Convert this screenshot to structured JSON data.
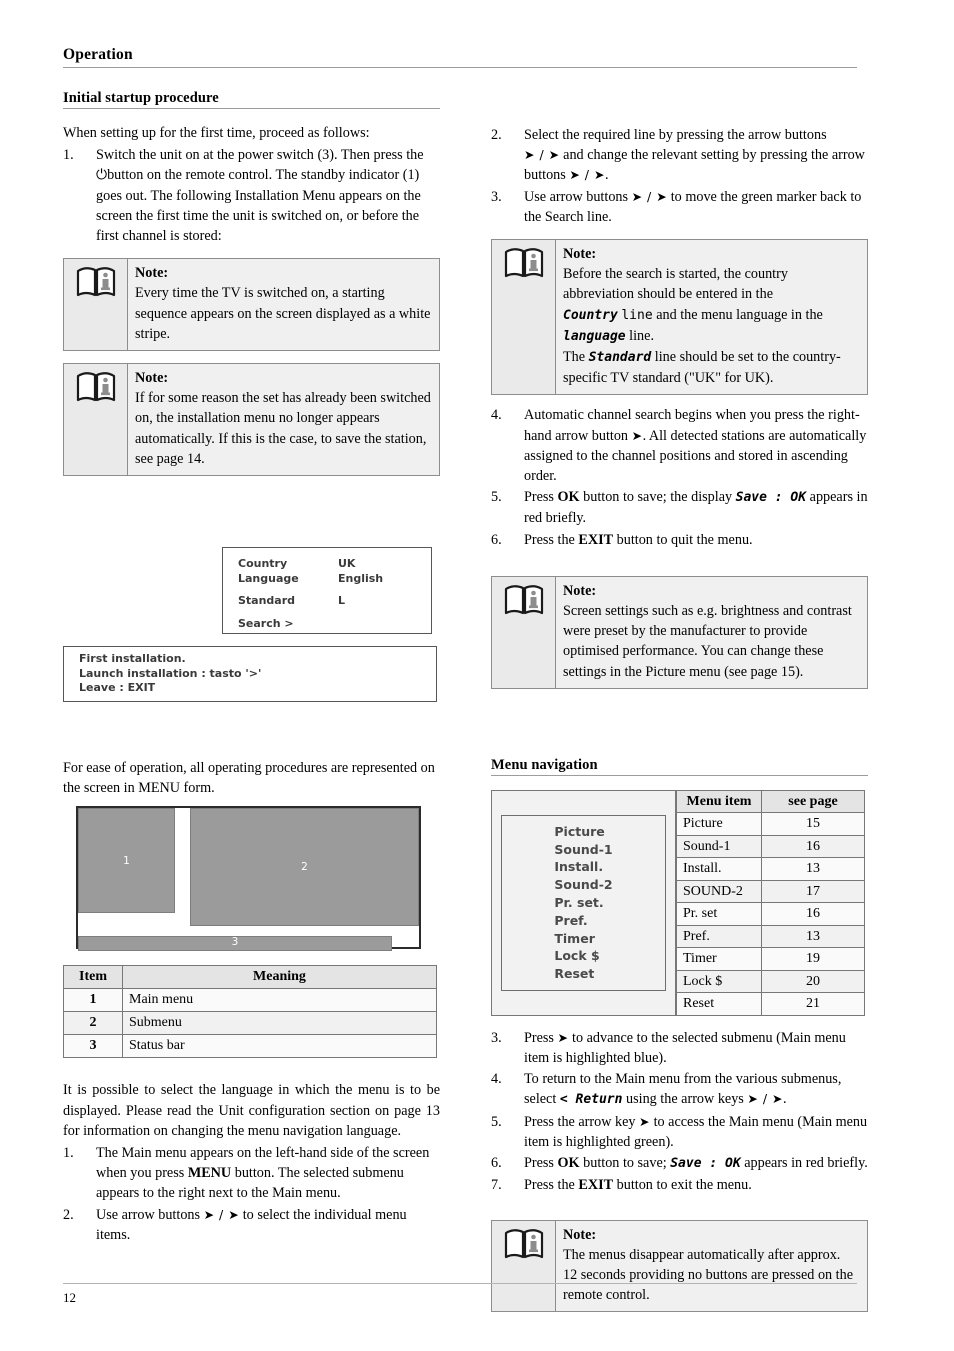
{
  "header": {
    "running_title": "Operation"
  },
  "footer": {
    "page_number": "12"
  },
  "left": {
    "section_title": "Initial startup procedure",
    "intro": "When setting up for the first time, proceed as follows:",
    "step1": {
      "num": "1.",
      "part_a": "Switch the unit on at the power switch (3). Then press the",
      "power_glyph": "⏻",
      "part_b": "button on the remote control. The standby indicator (1) goes out. The following Installation Menu appears on the screen the first time the unit is switched on, or before the first channel is stored:"
    },
    "note1": {
      "title": "Note:",
      "text": "Every time the TV is switched on, a starting sequence appears on the screen displayed as a white stripe."
    },
    "note2": {
      "title": "Note:",
      "text": "If for some reason the set has already been switched on, the installation menu no longer appears automatically. If this is the case, to save the station, see page 14."
    },
    "osd": {
      "rows": [
        {
          "key": "Country",
          "value": "UK"
        },
        {
          "key": "Language",
          "value": "English"
        },
        {
          "key": "Standard",
          "value": "L"
        },
        {
          "key": "Search  >",
          "value": ""
        }
      ],
      "status": [
        "First installation.",
        "Launch installation : tasto '>'",
        "Leave : EXIT"
      ]
    },
    "menu_form_text": "For ease of operation, all operating procedures are represented on the screen in MENU form.",
    "diagram": {
      "box1": "1",
      "box2": "2",
      "box3": "3"
    },
    "item_table": {
      "headers": [
        "Item",
        "Meaning"
      ],
      "rows": [
        [
          "1",
          "Main menu"
        ],
        [
          "2",
          "Submenu"
        ],
        [
          "3",
          "Status bar"
        ]
      ]
    },
    "language_para": "It is possible to select the language in which the menu is to be displayed. Please read the Unit configuration section on page 13 for information on changing the menu navigation language.",
    "steps_b": [
      {
        "num": "1.",
        "a": "The Main menu appears on the left-hand side of the screen when you press ",
        "bold": "MENU",
        "b": " button. The selected submenu appears to the right next to the Main menu."
      },
      {
        "num": "2.",
        "a": "Use arrow buttons ",
        "arrows": "➤ / ➤",
        "b": " to select the individual menu items."
      }
    ]
  },
  "right": {
    "step2": {
      "num": "2.",
      "a": "Select the required line by pressing the arrow buttons",
      "arrows_ud": "➤ / ➤",
      "b": " and change the relevant setting by pressing the arrow buttons ",
      "arrows_lr": "➤ / ➤",
      "c": "."
    },
    "step3": {
      "num": "3.",
      "a": "Use arrow buttons ",
      "arrows_ud": "➤ / ➤",
      "b": " to move the green marker back to the Search line."
    },
    "note3": {
      "title": "Note:",
      "l1_a": "Before the search is started, the country abbreviation should be entered in the ",
      "l1_kw": "Country",
      "l1_kw2": "line",
      "l1_b": " and the menu language in the ",
      "l1_kw3": "language",
      "l1_c": " line.",
      "l2_a": "The ",
      "l2_kw": "Standard",
      "l2_b": " line should be set to the country-specific TV standard (\"UK\" for UK)."
    },
    "step4": {
      "num": "4.",
      "a": "Automatic channel search begins when you press the right-hand arrow button ",
      "arrow": "➤",
      "b": ". All detected stations are automatically assigned to the channel positions and stored in ascending order."
    },
    "step5": {
      "num": "5.",
      "a": "Press ",
      "bold": "OK",
      "b": " button to save; the display ",
      "kw": "Save  :  OK",
      "c": " appears in red briefly."
    },
    "step6": {
      "num": "6.",
      "a": "Press the ",
      "bold": "EXIT",
      "b": " button to quit the menu."
    },
    "note4": {
      "title": "Note:",
      "text": "Screen settings such as e.g. brightness and contrast were preset by the manufacturer to provide optimised performance. You can change these settings in the Picture menu (see page 15)."
    },
    "section_title": "Menu navigation",
    "osd_menu_items": [
      "Picture",
      "Sound-1",
      "Install.",
      "Sound-2",
      "Pr. set.",
      "Pref.",
      "Timer",
      "Lock $",
      "Reset"
    ],
    "nav_table": {
      "headers": [
        "Menu item",
        "see page"
      ],
      "rows": [
        [
          "Picture",
          "15"
        ],
        [
          "Sound-1",
          "16"
        ],
        [
          "Install.",
          "13"
        ],
        [
          "SOUND-2",
          "17"
        ],
        [
          "Pr. set",
          "16"
        ],
        [
          "Pref.",
          "13"
        ],
        [
          "Timer",
          "19"
        ],
        [
          "Lock $",
          "20"
        ],
        [
          "Reset",
          "21"
        ]
      ]
    },
    "step7": {
      "num": "3.",
      "a": "Press ",
      "arrow": "➤",
      "b": " to advance to the selected submenu (Main menu item is highlighted blue)."
    },
    "step8": {
      "num": "4.",
      "a": "To return to the Main menu from the various submenus, select ",
      "kw": "<  Return",
      "b": " using the arrow keys ",
      "arrows": "➤ / ➤",
      "c": "."
    },
    "step9": {
      "num": "5.",
      "a": "Press the arrow key ",
      "arrow": "➤",
      "b": " to access the Main menu (Main menu item is highlighted green)."
    },
    "step10": {
      "num": "6.",
      "a": "Press ",
      "bold": "OK",
      "b": " button to save; ",
      "kw": "Save  :  OK",
      "c": " appears in red briefly."
    },
    "step11": {
      "num": "7.",
      "a": "Press the ",
      "bold": "EXIT",
      "b": " button to exit the menu."
    },
    "note5": {
      "title": "Note:",
      "l1": "The menus disappear automatically after approx.",
      "l2": "12 seconds providing no buttons are pressed on the remote control."
    }
  },
  "icons": {
    "note_book": "note-book-info-icon"
  },
  "colors": {
    "rule": "#9c9c9c",
    "note_bg": "#f0f0f0",
    "note_border": "#8d8d8d",
    "diagram_gray": "#9b9b9b",
    "table_header_bg": "#e4e4e4"
  }
}
